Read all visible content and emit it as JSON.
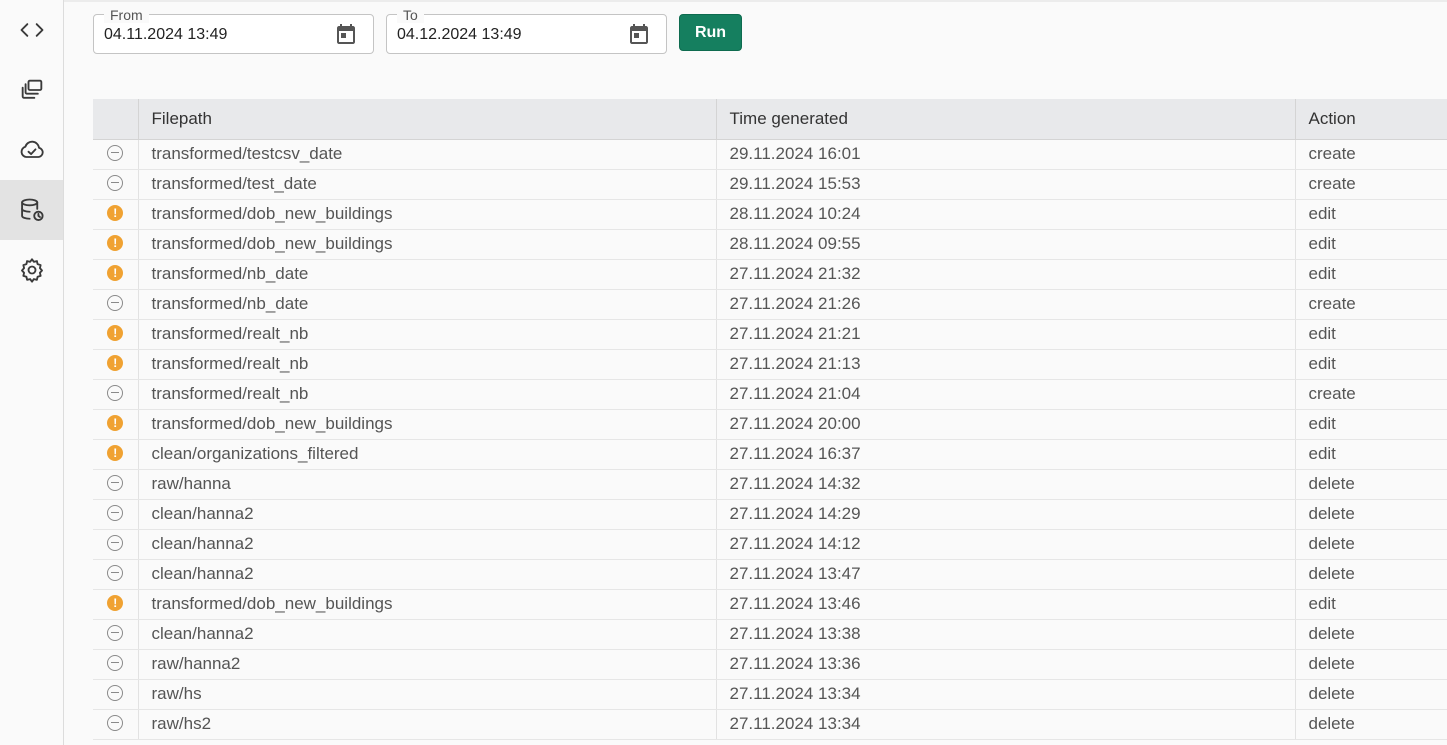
{
  "nav": [
    {
      "name": "code-icon",
      "active": false
    },
    {
      "name": "layers-icon",
      "active": false
    },
    {
      "name": "cloud-sync-icon",
      "active": false
    },
    {
      "name": "database-history-icon",
      "active": true
    },
    {
      "name": "gear-icon",
      "active": false
    }
  ],
  "filters": {
    "from_label": "From",
    "from_value": "04.11.2024 13:49",
    "to_label": "To",
    "to_value": "04.12.2024 13:49",
    "run_label": "Run"
  },
  "table": {
    "headers": [
      "Filepath",
      "Time generated",
      "Action"
    ],
    "rows": [
      {
        "status": "neutral",
        "filepath": "transformed/testcsv_date",
        "time": "29.11.2024 16:01",
        "action": "create"
      },
      {
        "status": "neutral",
        "filepath": "transformed/test_date",
        "time": "29.11.2024 15:53",
        "action": "create"
      },
      {
        "status": "warning",
        "filepath": "transformed/dob_new_buildings",
        "time": "28.11.2024 10:24",
        "action": "edit"
      },
      {
        "status": "warning",
        "filepath": "transformed/dob_new_buildings",
        "time": "28.11.2024 09:55",
        "action": "edit"
      },
      {
        "status": "warning",
        "filepath": "transformed/nb_date",
        "time": "27.11.2024 21:32",
        "action": "edit"
      },
      {
        "status": "neutral",
        "filepath": "transformed/nb_date",
        "time": "27.11.2024 21:26",
        "action": "create"
      },
      {
        "status": "warning",
        "filepath": "transformed/realt_nb",
        "time": "27.11.2024 21:21",
        "action": "edit"
      },
      {
        "status": "warning",
        "filepath": "transformed/realt_nb",
        "time": "27.11.2024 21:13",
        "action": "edit"
      },
      {
        "status": "neutral",
        "filepath": "transformed/realt_nb",
        "time": "27.11.2024 21:04",
        "action": "create"
      },
      {
        "status": "warning",
        "filepath": "transformed/dob_new_buildings",
        "time": "27.11.2024 20:00",
        "action": "edit"
      },
      {
        "status": "warning",
        "filepath": "clean/organizations_filtered",
        "time": "27.11.2024 16:37",
        "action": "edit"
      },
      {
        "status": "neutral",
        "filepath": "raw/hanna",
        "time": "27.11.2024 14:32",
        "action": "delete"
      },
      {
        "status": "neutral",
        "filepath": "clean/hanna2",
        "time": "27.11.2024 14:29",
        "action": "delete"
      },
      {
        "status": "neutral",
        "filepath": "clean/hanna2",
        "time": "27.11.2024 14:12",
        "action": "delete"
      },
      {
        "status": "neutral",
        "filepath": "clean/hanna2",
        "time": "27.11.2024 13:47",
        "action": "delete"
      },
      {
        "status": "warning",
        "filepath": "transformed/dob_new_buildings",
        "time": "27.11.2024 13:46",
        "action": "edit"
      },
      {
        "status": "neutral",
        "filepath": "clean/hanna2",
        "time": "27.11.2024 13:38",
        "action": "delete"
      },
      {
        "status": "neutral",
        "filepath": "raw/hanna2",
        "time": "27.11.2024 13:36",
        "action": "delete"
      },
      {
        "status": "neutral",
        "filepath": "raw/hs",
        "time": "27.11.2024 13:34",
        "action": "delete"
      },
      {
        "status": "neutral",
        "filepath": "raw/hs2",
        "time": "27.11.2024 13:34",
        "action": "delete"
      }
    ]
  }
}
